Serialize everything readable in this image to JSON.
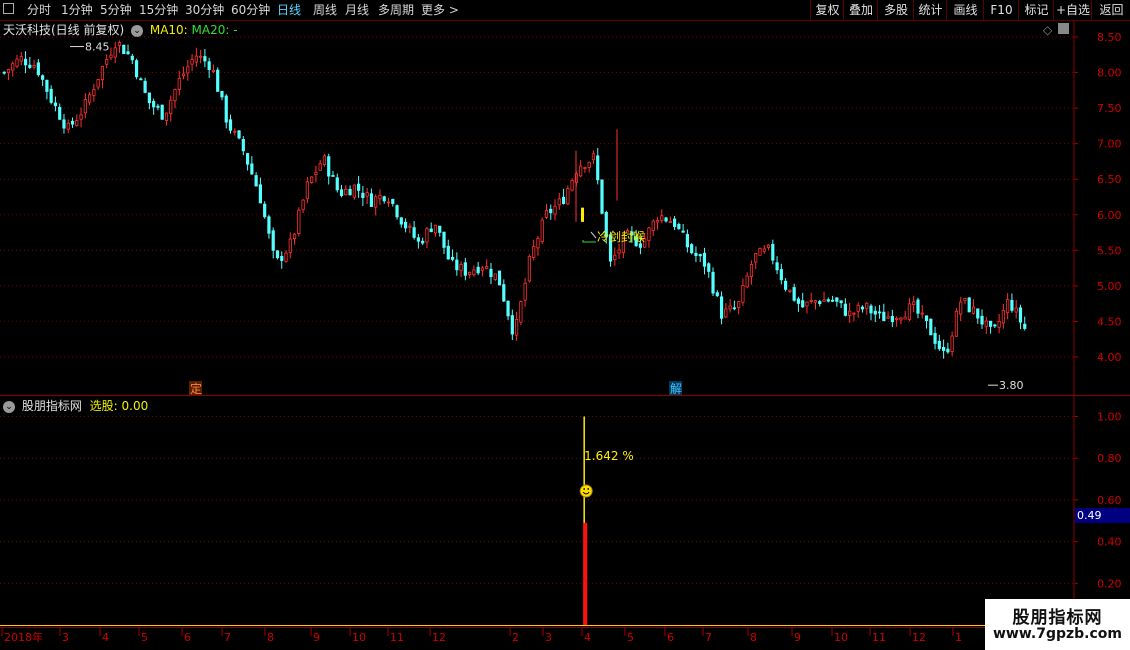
{
  "toolbar": {
    "periods": [
      "分时",
      "1分钟",
      "5分钟",
      "15分钟",
      "30分钟",
      "60分钟",
      "日线",
      "周线",
      "月线",
      "多周期",
      "更多 >"
    ],
    "active_period": "日线",
    "right_buttons": [
      "复权",
      "叠加",
      "多股",
      "统计",
      "画线",
      "F10",
      "标记",
      "+自选",
      "返回"
    ]
  },
  "main_panel": {
    "stock_name": "天沃科技(日线 前复权)",
    "ma10_label": "MA10:",
    "ma20_label": "MA20: -",
    "high_label": "8.45",
    "low_label": "3.80",
    "annotation": "冷剑封喉",
    "marker_ding": "定",
    "marker_jie": "解",
    "price_ticks": [
      "8.50",
      "8.00",
      "7.50",
      "7.00",
      "6.50",
      "6.00",
      "5.50",
      "5.00",
      "4.50",
      "4.00"
    ]
  },
  "sub_panel": {
    "title": "股朋指标网",
    "xuangu_label": "选股: 0.00",
    "percent_label": "1.642 %",
    "value_box": "0.49",
    "ticks": [
      "1.00",
      "0.80",
      "0.60",
      "0.40",
      "0.20"
    ]
  },
  "time_axis": [
    "2018年",
    "3",
    "4",
    "5",
    "6",
    "7",
    "8",
    "9",
    "10",
    "11",
    "12",
    "2",
    "3",
    "4",
    "5",
    "6",
    "7",
    "8",
    "9",
    "10",
    "11",
    "12",
    "1"
  ],
  "watermark": {
    "line1": "股朋指标网",
    "line2": "www.7gpzb.com"
  },
  "chart_data": {
    "type": "candlestick",
    "price_axis": {
      "ylim": [
        3.6,
        8.8
      ],
      "ticks": [
        8.5,
        8.0,
        7.5,
        7.0,
        6.5,
        6.0,
        5.5,
        5.0,
        4.5,
        4.0
      ]
    },
    "indicator_axis": {
      "ylim": [
        0,
        1.05
      ],
      "ticks": [
        1.0,
        0.8,
        0.6,
        0.4,
        0.2
      ]
    },
    "close_path": [
      8.0,
      8.2,
      8.1,
      7.6,
      7.2,
      7.5,
      8.0,
      8.45,
      8.2,
      7.6,
      7.4,
      7.9,
      8.25,
      8.1,
      7.3,
      6.9,
      6.3,
      5.3,
      5.6,
      6.4,
      6.8,
      6.3,
      6.4,
      6.2,
      6.3,
      5.9,
      5.6,
      5.9,
      5.3,
      5.2,
      5.3,
      5.1,
      4.3,
      5.4,
      6.0,
      6.2,
      6.7,
      6.8,
      5.3,
      5.7,
      5.6,
      6.0,
      5.9,
      5.5,
      5.3,
      4.6,
      4.7,
      5.4,
      5.5,
      5.0,
      4.7,
      4.8,
      4.8,
      4.6,
      4.7,
      4.55,
      4.6,
      4.7,
      4.4,
      4.0,
      4.8,
      4.6,
      4.3,
      4.8,
      4.4
    ],
    "extremes": {
      "high": 8.45,
      "low": 3.8
    },
    "signal": {
      "position": 0.516,
      "indicator_value": 1.0,
      "red_bar": 0.49
    }
  }
}
